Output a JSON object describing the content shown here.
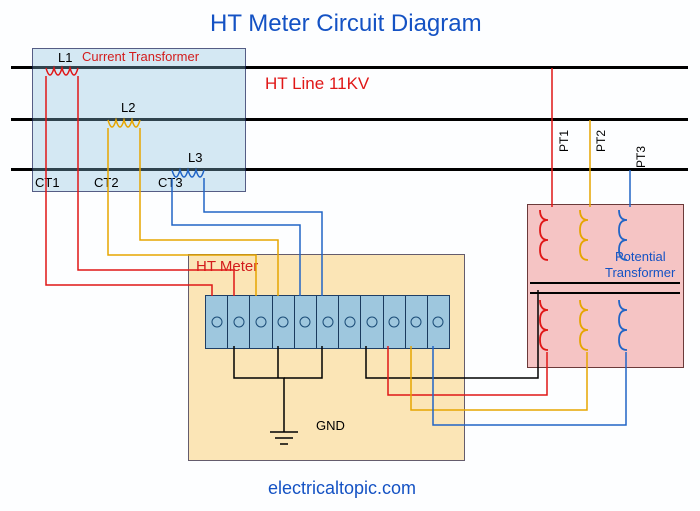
{
  "title": "HT Meter Circuit Diagram",
  "ht_line_label": "HT Line 11KV",
  "ct": {
    "box_label": "Current Transformer",
    "phases": [
      "L1",
      "L2",
      "L3"
    ],
    "labels": [
      "CT1",
      "CT2",
      "CT3"
    ]
  },
  "meter": {
    "label": "HT Meter",
    "gnd": "GND",
    "terminal_count": 11
  },
  "pt": {
    "label": "Potential Transformer",
    "phases": [
      "PT1",
      "PT2",
      "PT3"
    ]
  },
  "footer": "electricaltopic.com",
  "colors": {
    "red": "#e01717",
    "yellow": "#e6a500",
    "blue": "#2165c6",
    "black": "#000000",
    "title_blue": "#1452c4"
  }
}
